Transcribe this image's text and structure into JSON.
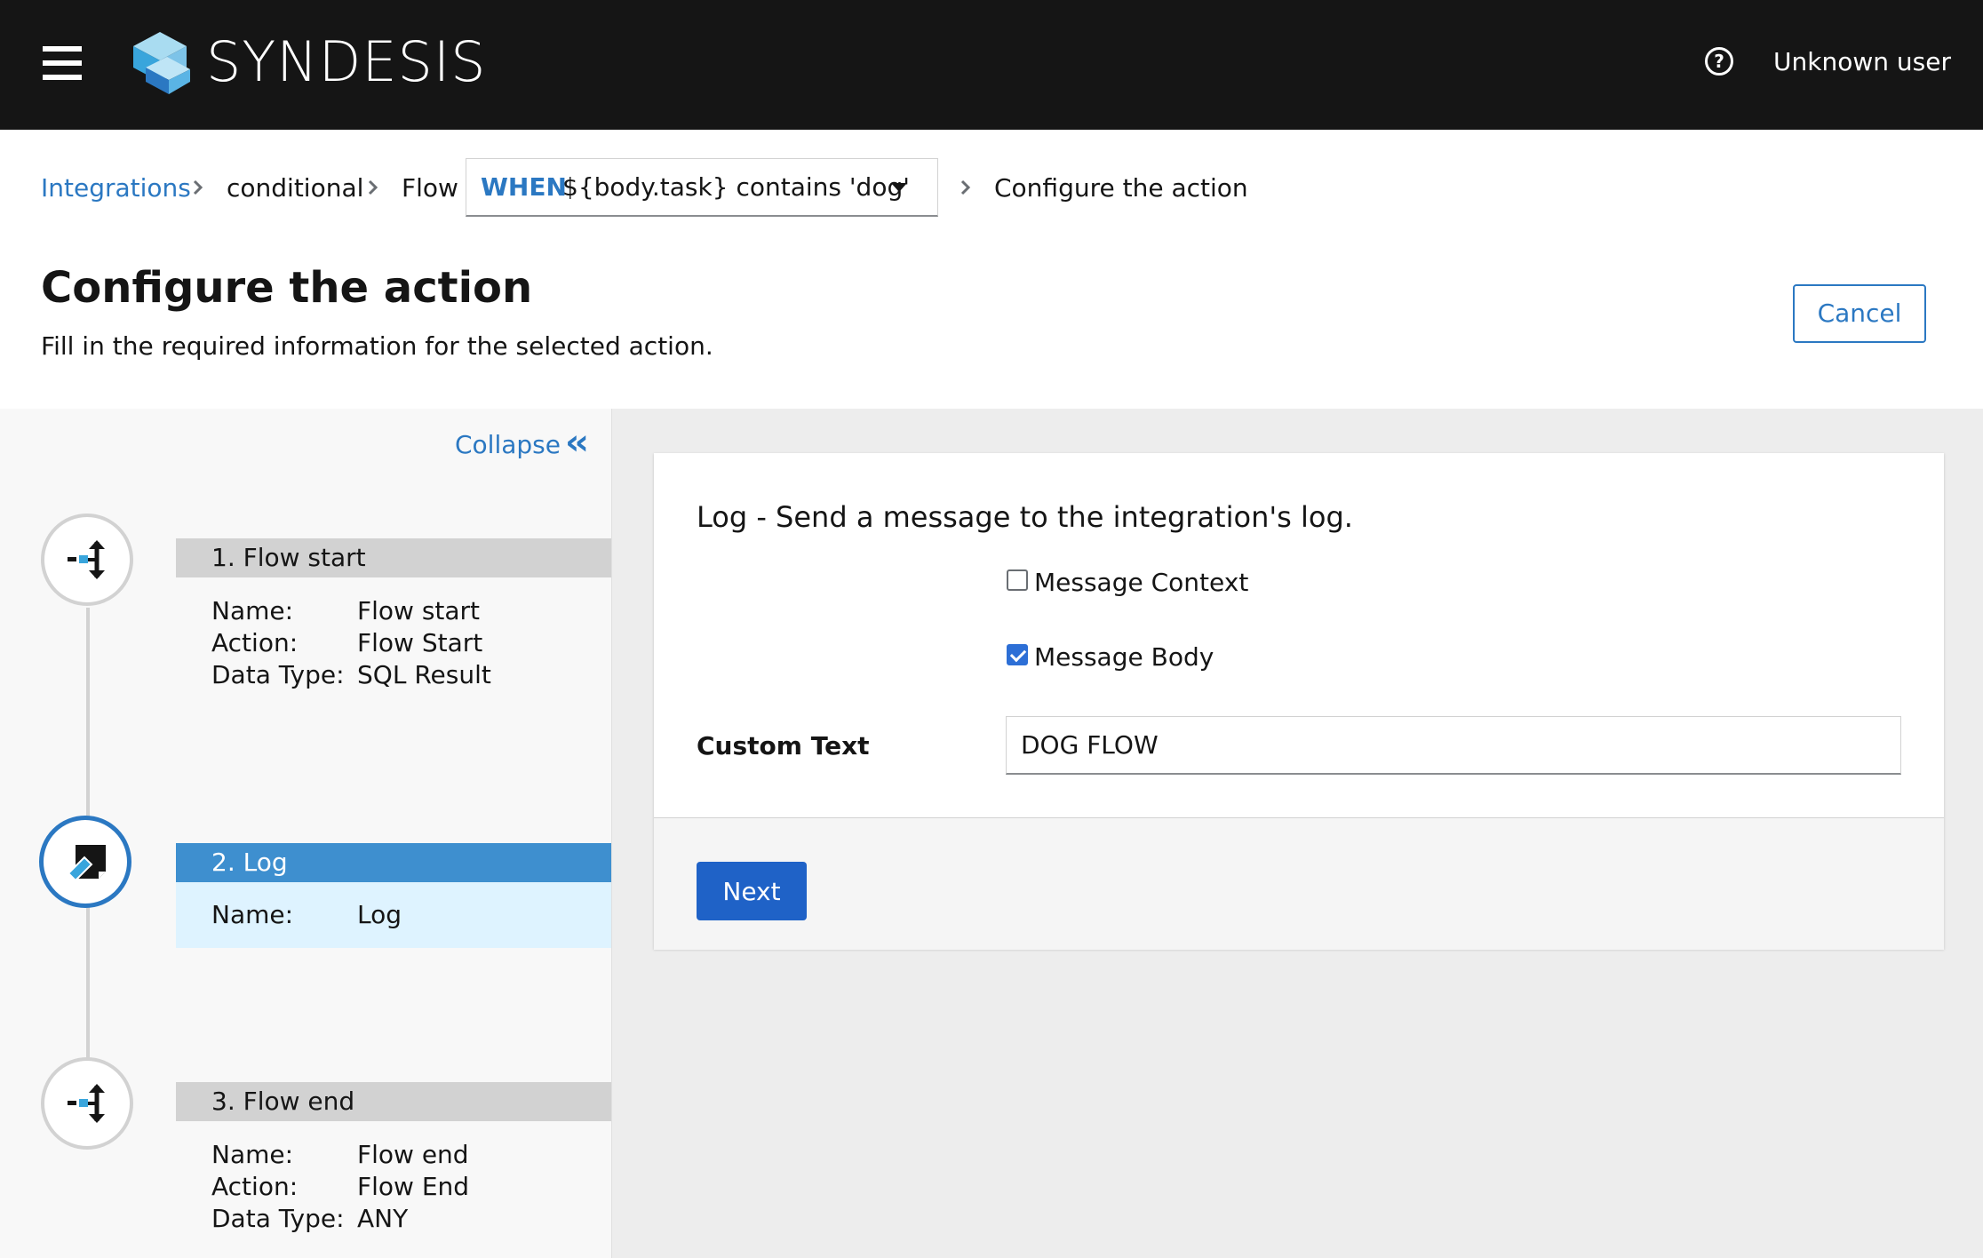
{
  "app": {
    "brand": "SYNDESIS",
    "user_name": "Unknown user"
  },
  "breadcrumb": {
    "integrations": "Integrations",
    "integration_name": "conditional",
    "flow": "Flow",
    "flow_select": {
      "keyword": "WHEN",
      "expression": "${body.task} contains 'dog'"
    },
    "current": "Configure the action"
  },
  "header": {
    "title": "Configure the action",
    "description": "Fill in the required information for the selected action.",
    "cancel_label": "Cancel"
  },
  "sidebar": {
    "collapse_label": "Collapse",
    "steps": [
      {
        "title": "1. Flow start",
        "rows": [
          {
            "key": "Name:",
            "value": "Flow start"
          },
          {
            "key": "Action:",
            "value": "Flow Start"
          },
          {
            "key": "Data Type:",
            "value": "SQL Result"
          }
        ]
      },
      {
        "title": "2. Log",
        "rows": [
          {
            "key": "Name:",
            "value": "Log"
          }
        ]
      },
      {
        "title": "3. Flow end",
        "rows": [
          {
            "key": "Name:",
            "value": "Flow end"
          },
          {
            "key": "Action:",
            "value": "Flow End"
          },
          {
            "key": "Data Type:",
            "value": "ANY"
          }
        ]
      }
    ]
  },
  "form": {
    "title": "Log - Send a message to the integration's log.",
    "message_context": {
      "label": "Message Context",
      "checked": false
    },
    "message_body": {
      "label": "Message Body",
      "checked": true
    },
    "custom_text": {
      "label": "Custom Text",
      "value": "DOG FLOW"
    },
    "next_label": "Next"
  },
  "colors": {
    "brand_blue": "#2b78c2",
    "primary_button": "#1f62c7",
    "active_step": "#3e8fcf"
  }
}
